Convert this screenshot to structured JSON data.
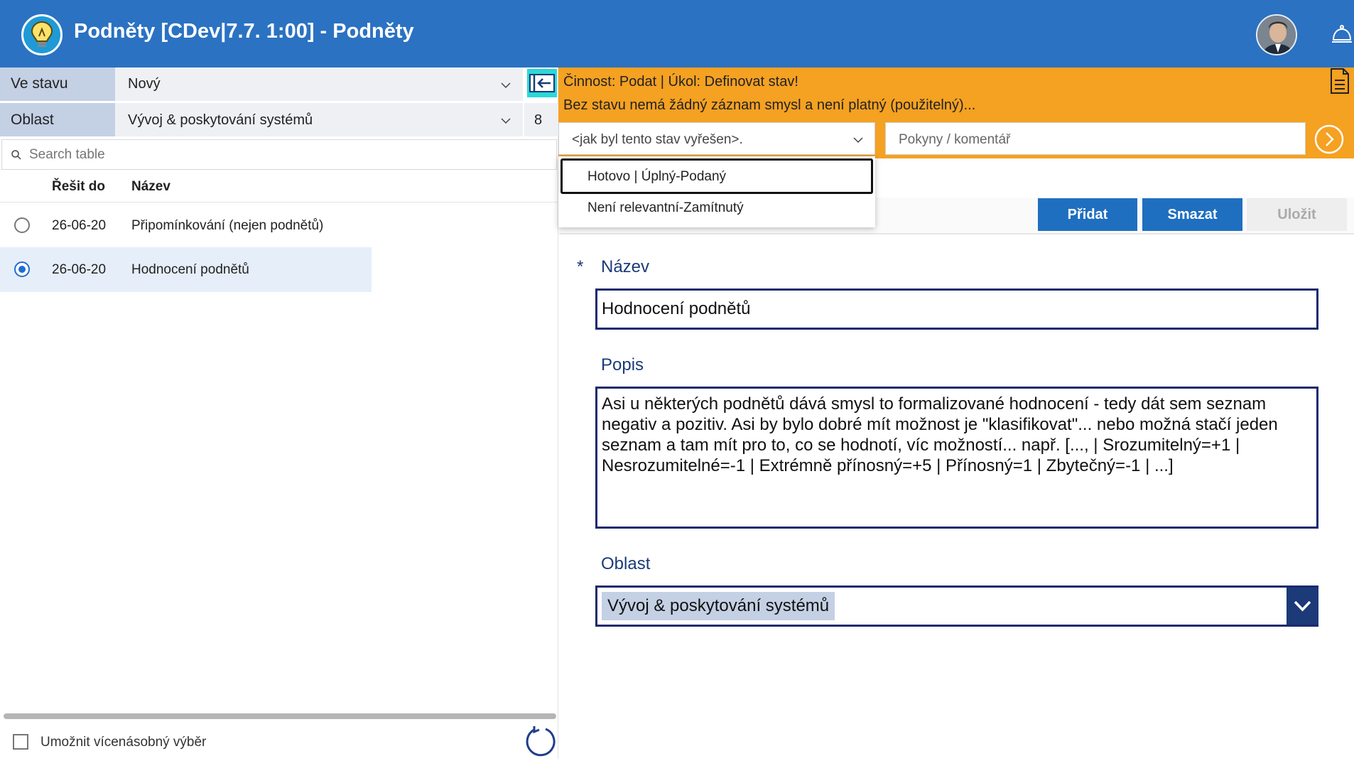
{
  "header": {
    "title": "Podněty [CDev|7.7. 1:00] - Podněty",
    "logo_icon": "lightbulb-icon",
    "avatar_icon": "user-avatar",
    "bell_icon": "service-bell-icon"
  },
  "filters": {
    "state": {
      "label": "Ve stavu",
      "value": "Nový"
    },
    "area": {
      "label": "Oblast",
      "value": "Vývoj & poskytování systémů",
      "count": "8"
    }
  },
  "search": {
    "placeholder": "Search table"
  },
  "table": {
    "columns": [
      "Řešit do",
      "Název"
    ],
    "rows": [
      {
        "date": "26-06-20",
        "name": "Připomínkování (nejen podnětů)",
        "selected": false
      },
      {
        "date": "26-06-20",
        "name": "Hodnocení podnětů",
        "selected": true
      }
    ]
  },
  "footer": {
    "multi_select_label": "Umožnit vícenásobný výběr"
  },
  "banner": {
    "line1": "Činnost: Podat | Úkol: Definovat stav!",
    "line2": "Bez stavu nemá žádný záznam smysl a není platný (použitelný)..."
  },
  "resolve": {
    "placeholder": "<jak byl tento stav vyřešen>.",
    "options": [
      "Hotovo | Úplný-Podaný",
      "Není relevantní-Zamítnutý"
    ]
  },
  "comment": {
    "placeholder": "Pokyny / komentář"
  },
  "toolbar": {
    "add_label": "Přidat",
    "delete_label": "Smazat",
    "save_label": "Uložit"
  },
  "form": {
    "name_label": "Název",
    "required_marker": "*",
    "name_value": "Hodnocení podnětů",
    "description_label": "Popis",
    "description_value": "Asi u některých podnětů dává smysl to formalizované hodnocení - tedy dát sem seznam negativ a pozitiv. Asi by bylo dobré mít možnost je \"klasifikovat\"... nebo možná stačí jeden seznam a tam mít pro to, co se hodnotí, víc možností... např. [..., | Srozumitelný=+1 | Nesrozumitelné=-1 | Extrémně přínosný=+5 | Přínosný=1 | Zbytečný=-1 | ...]",
    "area_label": "Oblast",
    "area_value": "Vývoj & poskytování systémů"
  },
  "colors": {
    "header": "#2b72c2",
    "banner": "#f5a122",
    "button": "#1f6fc0",
    "selected_row": "#e6eef9",
    "field_border": "#1c2a6e"
  }
}
